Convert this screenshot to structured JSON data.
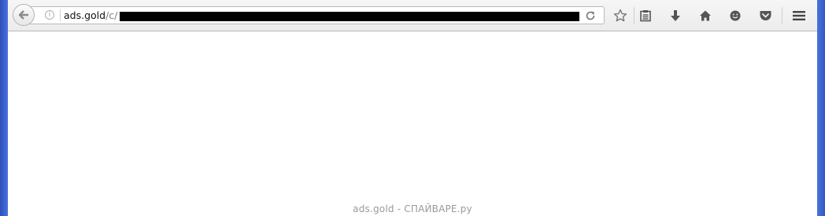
{
  "browser": {
    "url_bar": {
      "host": "ads.gold",
      "path_visible": "/c/"
    },
    "icons": {
      "back": "back-arrow-icon",
      "info": "info-icon",
      "reload": "reload-icon",
      "bookmark": "star-icon",
      "reading_list": "clipboard-icon",
      "downloads": "download-arrow-icon",
      "home": "home-icon",
      "hello": "chat-smiley-icon",
      "pocket": "pocket-icon",
      "menu": "hamburger-menu-icon"
    },
    "colors": {
      "desktop_blue": "#3d63d2",
      "toolbar": "#f0f0f0",
      "icon": "#555555"
    }
  },
  "page": {
    "watermark": "ads.gold - СПАЙВАРЕ.ру"
  }
}
